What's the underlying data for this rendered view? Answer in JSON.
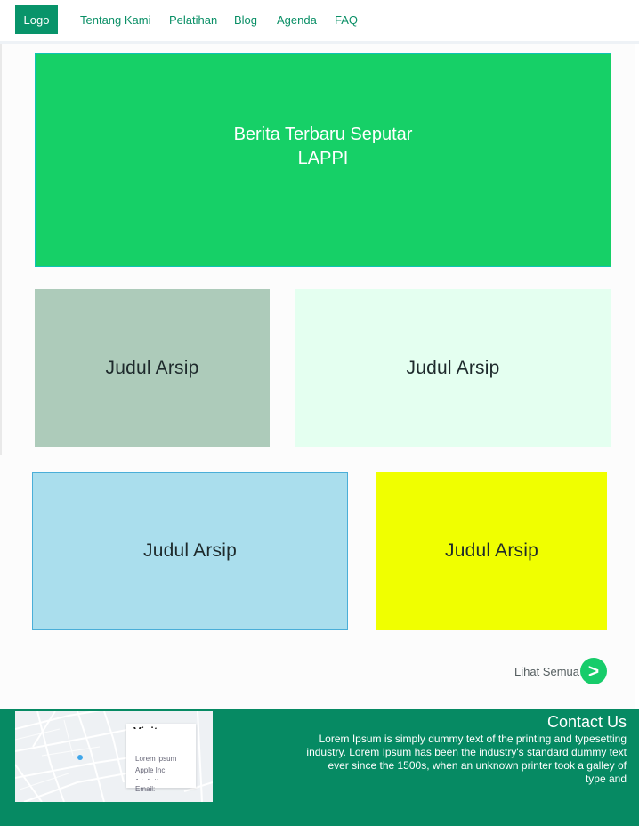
{
  "navbar": {
    "logo": "Logo",
    "links": [
      "Tentang Kami",
      "Pelatihan",
      "Blog",
      "Agenda",
      "FAQ"
    ]
  },
  "hero": {
    "title": "Berita Terbaru Seputar LAPPI"
  },
  "cards": [
    {
      "label": "Judul Arsip",
      "color": "#adcbba"
    },
    {
      "label": "Judul Arsip",
      "color": "#e4fff0"
    },
    {
      "label": "Judul Arsip",
      "color": "#aadeed"
    },
    {
      "label": "Judul Arsip",
      "color": "#f0ff00"
    }
  ],
  "see_all": {
    "label": "Lihat Semua",
    "button_icon": ">"
  },
  "footer": {
    "map_card": {
      "title": "Visit",
      "line1": "Lorem ipsum",
      "line2": "Apple Inc.",
      "line3": "1 Infinite",
      "line4": "Email:"
    },
    "contact_title": "Contact Us",
    "contact_text": "Lorem Ipsum is simply dummy text of the printing and typesetting industry. Lorem Ipsum has been the industry's standard dummy text ever since the 1500s, when an unknown printer took a galley of type and"
  },
  "colors": {
    "brand": "#08946a",
    "hero": "#16d067",
    "footer": "#068a63",
    "accent_button": "#17cc6a"
  }
}
